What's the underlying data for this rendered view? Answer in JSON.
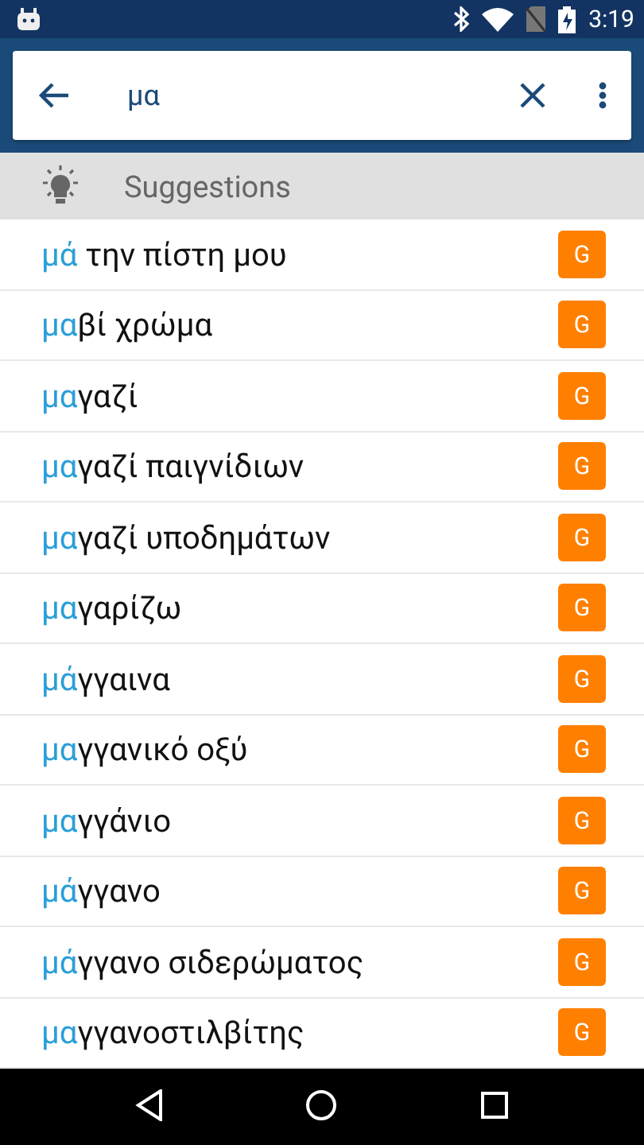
{
  "status_bar": {
    "time": "3:19"
  },
  "search": {
    "value": "μα"
  },
  "section": {
    "title": "Suggestions"
  },
  "suggestions": [
    {
      "match": "μά",
      "rest": " την πίστη μου",
      "badge": "G"
    },
    {
      "match": "μα",
      "rest": "βί χρώμα",
      "badge": "G"
    },
    {
      "match": "μα",
      "rest": "γαζί",
      "badge": "G"
    },
    {
      "match": "μα",
      "rest": "γαζί παιγνίδιων",
      "badge": "G"
    },
    {
      "match": "μα",
      "rest": "γαζί υποδημάτων",
      "badge": "G"
    },
    {
      "match": "μα",
      "rest": "γαρίζω",
      "badge": "G"
    },
    {
      "match": "μά",
      "rest": "γγαινα",
      "badge": "G"
    },
    {
      "match": "μα",
      "rest": "γγανικό οξύ",
      "badge": "G"
    },
    {
      "match": "μα",
      "rest": "γγάνιο",
      "badge": "G"
    },
    {
      "match": "μά",
      "rest": "γγανο",
      "badge": "G"
    },
    {
      "match": "μά",
      "rest": "γγανο σιδερώματος",
      "badge": "G"
    },
    {
      "match": "μα",
      "rest": "γγανοστιλβίτης",
      "badge": "G"
    }
  ]
}
